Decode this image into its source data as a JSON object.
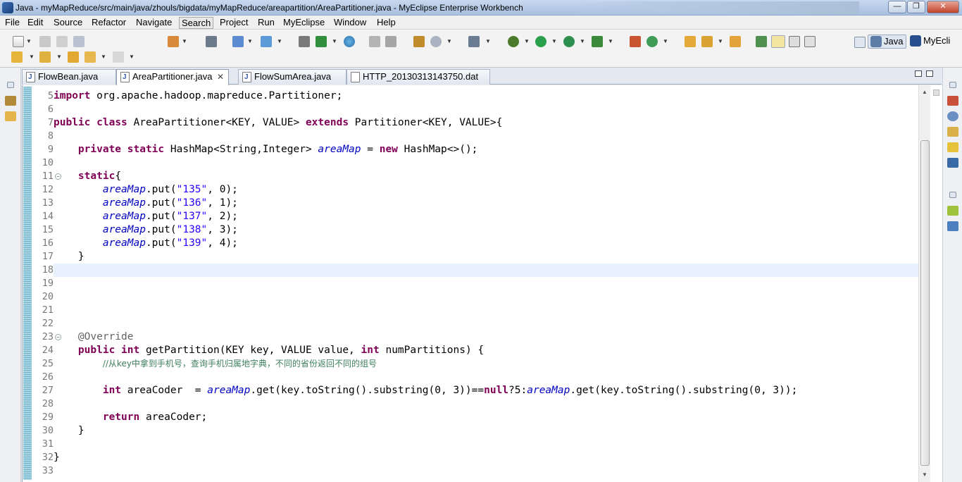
{
  "window": {
    "title": "Java - myMapReduce/src/main/java/zhouls/bigdata/myMapReduce/areapartition/AreaPartitioner.java - MyEclipse Enterprise Workbench",
    "min_label": "—",
    "max_label": "❐",
    "close_label": "✕"
  },
  "menu": [
    "File",
    "Edit",
    "Source",
    "Refactor",
    "Navigate",
    "Search",
    "Project",
    "Run",
    "MyEclipse",
    "Window",
    "Help"
  ],
  "perspectives": {
    "java": "Java",
    "myecli": "MyEcli"
  },
  "tabs": [
    {
      "label": "FlowBean.java",
      "active": false
    },
    {
      "label": "AreaPartitioner.java",
      "active": true,
      "close": "✕"
    },
    {
      "label": "FlowSumArea.java",
      "active": false
    },
    {
      "label": "HTTP_20130313143750.dat",
      "active": false
    }
  ],
  "editor": {
    "line_numbers": [
      "5",
      "6",
      "7",
      "8",
      "9",
      "10",
      "11",
      "12",
      "13",
      "14",
      "15",
      "16",
      "17",
      "18",
      "19",
      "20",
      "21",
      "22",
      "23",
      "24",
      "25",
      "26",
      "27",
      "28",
      "29",
      "30",
      "31",
      "32",
      "33"
    ],
    "current_line": "18",
    "fold_marks": [
      "11",
      "23"
    ],
    "code": [
      "import org.apache.hadoop.mapreduce.Partitioner;",
      "",
      "public class AreaPartitioner<KEY, VALUE> extends Partitioner<KEY, VALUE>{",
      "",
      "    private static HashMap<String,Integer> areaMap = new HashMap<>();",
      "",
      "    static{",
      "        areaMap.put(\"135\", 0);",
      "        areaMap.put(\"136\", 1);",
      "        areaMap.put(\"137\", 2);",
      "        areaMap.put(\"138\", 3);",
      "        areaMap.put(\"139\", 4);",
      "    }",
      "",
      "",
      "",
      "",
      "",
      "    @Override",
      "    public int getPartition(KEY key, VALUE value, int numPartitions) {",
      "        //从key中拿到手机号，查询手机归属地字典，不同的省份返回不同的组号",
      "",
      "        int areaCoder  = areaMap.get(key.toString().substring(0, 3))==null?5:areaMap.get(key.toString().substring(0, 3));",
      "",
      "        return areaCoder;",
      "    }",
      "",
      "}",
      ""
    ]
  },
  "colors": {
    "keyword": "#7f0055",
    "string": "#2a00ff",
    "field": "#0000c0",
    "comment": "#3f7f5f",
    "annotation": "#646464",
    "current_line_bg": "#e8f2fe"
  }
}
